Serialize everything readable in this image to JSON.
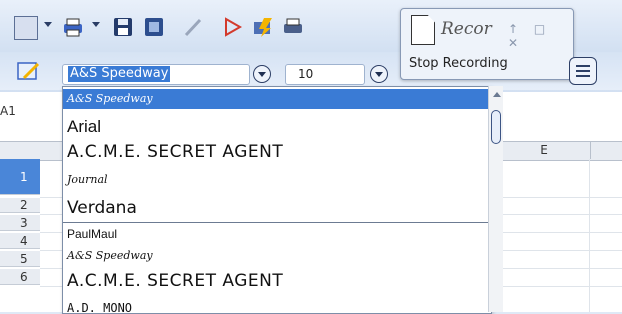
{
  "recording_panel": {
    "title": "Recor",
    "controls": "↑ □ ✕",
    "stop_label": "Stop Recording"
  },
  "font_name": {
    "value": "A&S Speedway"
  },
  "font_size": {
    "value": "10"
  },
  "name_box": {
    "value": "A1"
  },
  "column_header": {
    "label": "E"
  },
  "row_headers": [
    "1",
    "2",
    "3",
    "4",
    "5",
    "6"
  ],
  "font_list": {
    "items": [
      {
        "label": "A&S Speedway",
        "selected": true
      },
      {
        "label": "Arial"
      },
      {
        "label": "A.C.M.E. SECRET AGENT"
      },
      {
        "label": "Journal"
      },
      {
        "label": "Verdana"
      },
      {
        "label": "PaulMaul"
      },
      {
        "label": "A&S Speedway"
      },
      {
        "label": "A.C.M.E. SECRET AGENT"
      },
      {
        "label": "A.D. MONO"
      }
    ]
  },
  "colors": {
    "accent": "#3a7bd5",
    "toolbar": "#d6e3f4"
  }
}
